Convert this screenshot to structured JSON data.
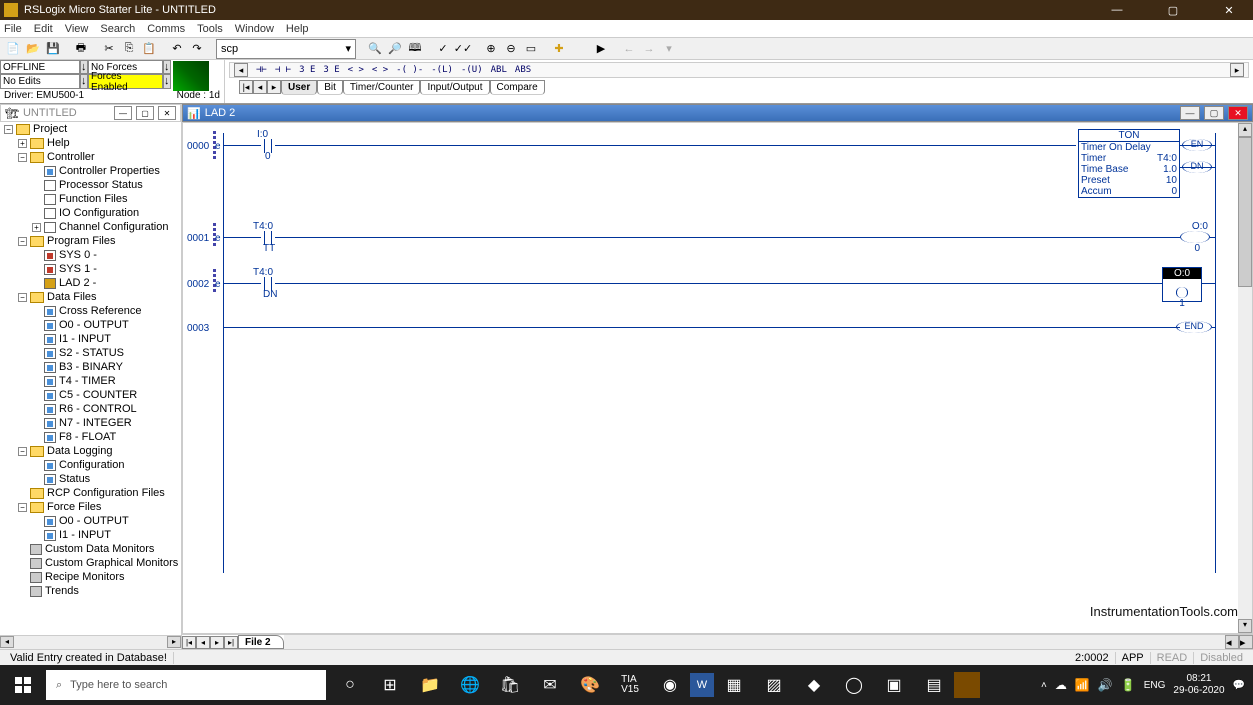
{
  "app": {
    "title": "RSLogix Micro Starter Lite - UNTITLED",
    "min": "—",
    "max": "▢",
    "close": "✕"
  },
  "menu": [
    "File",
    "Edit",
    "View",
    "Search",
    "Comms",
    "Tools",
    "Window",
    "Help"
  ],
  "toolbar": {
    "combo": "scp"
  },
  "status": {
    "offline": "OFFLINE",
    "noforces": "No Forces",
    "noedits": "No Edits",
    "forcesenabled": "Forces Enabled",
    "driver": "Driver: EMU500-1",
    "node": "Node : 1d"
  },
  "instrtabs": [
    "User",
    "Bit",
    "Timer/Counter",
    "Input/Output",
    "Compare"
  ],
  "instricons": [
    "⊣⊢",
    "⊣ ⊢",
    "3 E",
    "3 E",
    "< >",
    "< >",
    "-( )-",
    "-(L)",
    "-(U)",
    "ABL",
    "ABS"
  ],
  "treetitle": "UNTITLED",
  "tree": {
    "root": "Project",
    "help": "Help",
    "controller": "Controller",
    "cprops": "Controller Properties",
    "pstatus": "Processor Status",
    "ffiles": "Function Files",
    "ioconfig": "IO Configuration",
    "chconfig": "Channel Configuration",
    "progfiles": "Program Files",
    "sys0": "SYS 0 -",
    "sys1": "SYS 1 -",
    "lad2": "LAD 2 -",
    "datafiles": "Data Files",
    "xref": "Cross Reference",
    "o0": "O0 - OUTPUT",
    "i1": "I1 - INPUT",
    "s2": "S2 - STATUS",
    "b3": "B3 - BINARY",
    "t4": "T4 - TIMER",
    "c5": "C5 - COUNTER",
    "r6": "R6 - CONTROL",
    "n7": "N7 - INTEGER",
    "f8": "F8 - FLOAT",
    "datalog": "Data Logging",
    "config": "Configuration",
    "statusn": "Status",
    "rcp": "RCP Configuration Files",
    "forcefiles": "Force Files",
    "fo0": "O0 - OUTPUT",
    "fi1": "I1 - INPUT",
    "cdm": "Custom Data Monitors",
    "cgm": "Custom Graphical Monitors",
    "rm": "Recipe Monitors",
    "trends": "Trends"
  },
  "lad": {
    "title": "LAD 2",
    "rungs": [
      "0000",
      "0001",
      "0002",
      "0003"
    ],
    "r0": {
      "input": "I:0",
      "inputbit": "0"
    },
    "r1": {
      "tag": "T4:0",
      "sub": "TT",
      "out": "O:0",
      "outbit": "0"
    },
    "r2": {
      "tag": "T4:0",
      "sub": "DN",
      "out": "O:0",
      "outbit": "1"
    },
    "end": "END",
    "ton": {
      "name": "TON",
      "desc": "Timer On Delay",
      "fields": {
        "Timer": "T4:0",
        "Time Base": "1.0",
        "Preset": "10",
        "Accum": "0"
      },
      "en": "EN",
      "dn": "DN"
    },
    "filetab": "File 2",
    "watermark": "InstrumentationTools.com"
  },
  "appbar": {
    "msg": "Valid Entry created in Database!",
    "pos": "2:0002",
    "app": "APP",
    "read": "READ",
    "disabled": "Disabled"
  },
  "taskbar": {
    "search": "Type here to search",
    "lang": "ENG",
    "time": "08:21",
    "date": "29-06-2020"
  }
}
